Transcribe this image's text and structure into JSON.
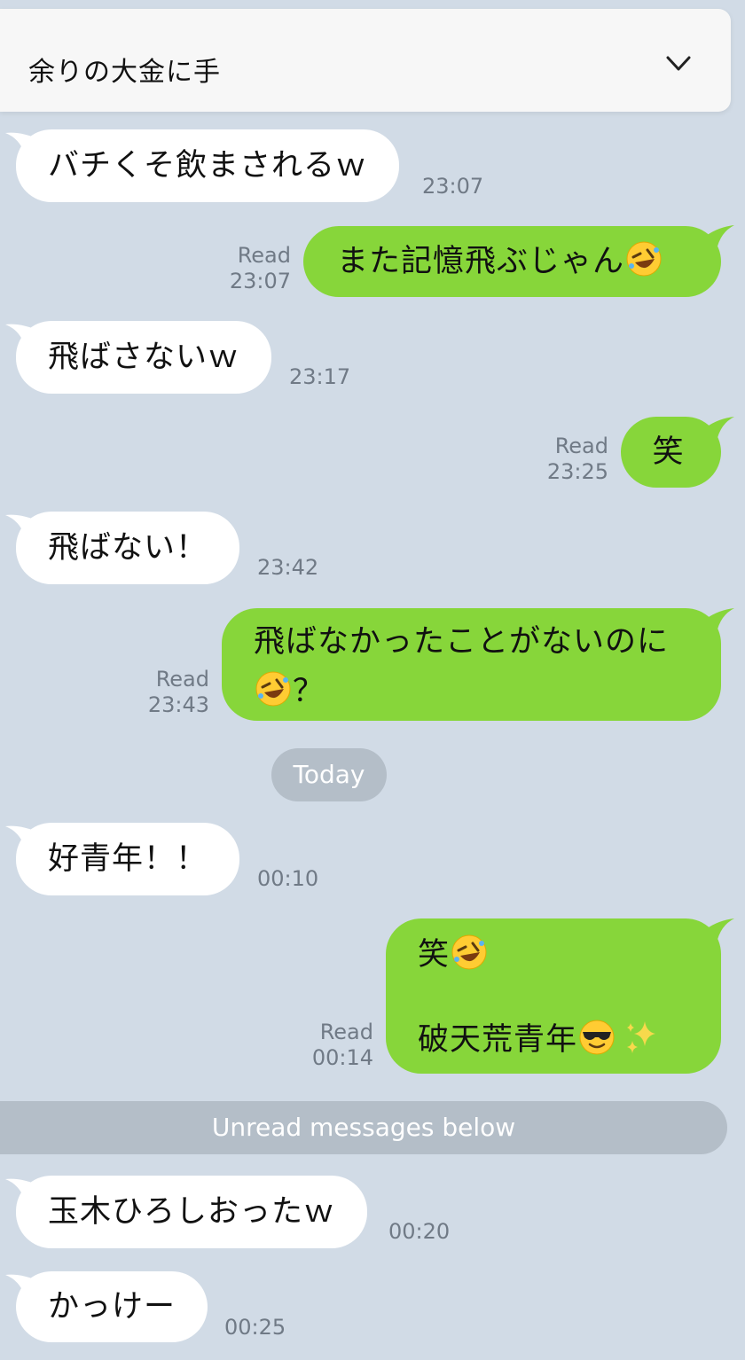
{
  "header": {
    "title": "余りの大金に手"
  },
  "icons": {
    "collapse": "chevron-down-icon",
    "laugh": "rolling-on-floor-laughing-emoji",
    "cool": "sunglasses-face-emoji",
    "sparkles": "sparkles-emoji"
  },
  "colors": {
    "background": "#d1dbe6",
    "incoming": "#ffffff",
    "outgoing": "#87d63a",
    "divider": "#b4bec8"
  },
  "messages": [
    {
      "dir": "in",
      "text": "バチくそ飲まされるｗ",
      "time": "23:07"
    },
    {
      "dir": "out",
      "text": "また記憶飛ぶじゃん",
      "read": "Read",
      "time": "23:07"
    },
    {
      "dir": "in",
      "text": "飛ばさないｗ",
      "time": "23:17"
    },
    {
      "dir": "out",
      "text": "笑",
      "read": "Read",
      "time": "23:25"
    },
    {
      "dir": "in",
      "text": "飛ばない！",
      "time": "23:42"
    },
    {
      "dir": "out",
      "text1": "飛ばなかったことがないのに",
      "text2": "？",
      "read": "Read",
      "time": "23:43"
    },
    {
      "dir": "in",
      "text": "好青年！！",
      "time": "00:10"
    },
    {
      "dir": "out",
      "text1": "笑",
      "text2": "破天荒青年",
      "read": "Read",
      "time": "00:14"
    },
    {
      "dir": "in",
      "text": "玉木ひろしおったｗ",
      "time": "00:20"
    },
    {
      "dir": "in",
      "text": "かっけー",
      "time": "00:25"
    }
  ],
  "dividers": {
    "date": "Today",
    "unread": "Unread messages below"
  }
}
